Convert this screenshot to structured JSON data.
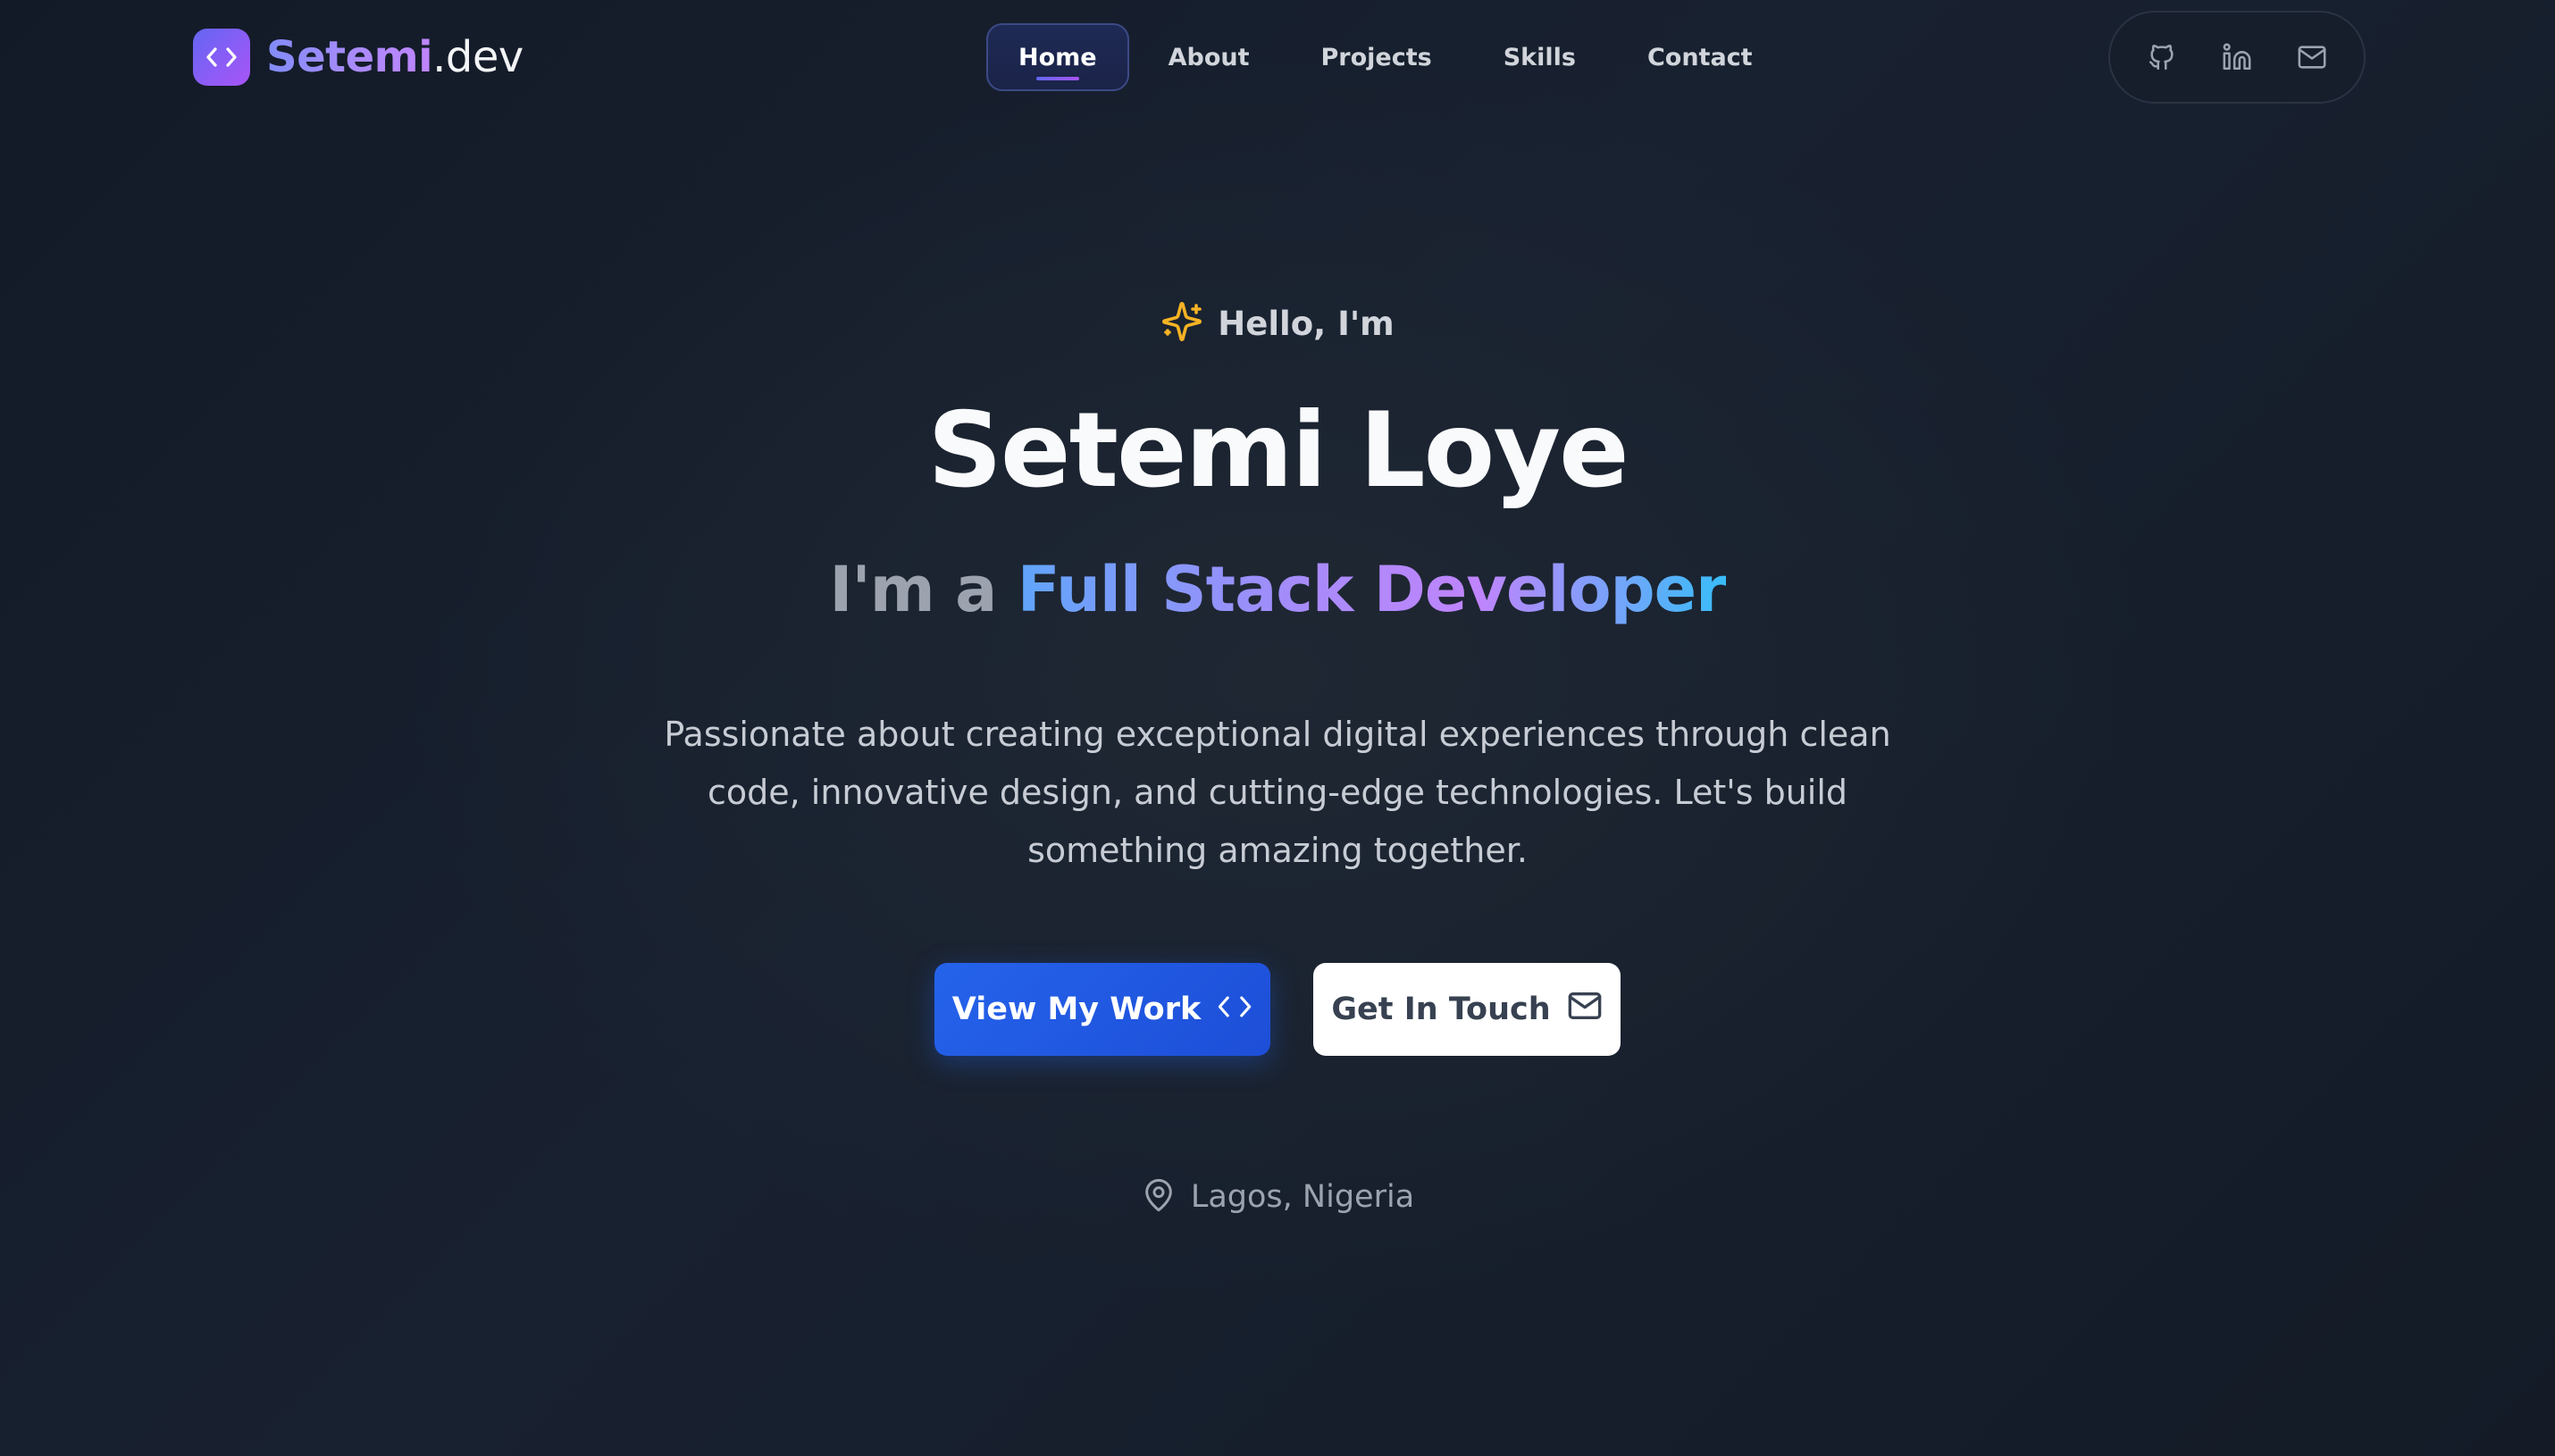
{
  "brand": {
    "name": "Setemi",
    "tld": ".dev",
    "icon": "code-brackets-icon",
    "gradient": [
      "#6366f1",
      "#a855f7"
    ]
  },
  "nav": {
    "items": [
      {
        "label": "Home",
        "active": true
      },
      {
        "label": "About",
        "active": false
      },
      {
        "label": "Projects",
        "active": false
      },
      {
        "label": "Skills",
        "active": false
      },
      {
        "label": "Contact",
        "active": false
      }
    ]
  },
  "social": {
    "icons": [
      "github-icon",
      "linkedin-icon",
      "mail-icon"
    ]
  },
  "hero": {
    "greeting": "Hello, I'm",
    "greeting_icon": "sparkles-icon",
    "name": "Setemi Loye",
    "role_prefix": "I'm a",
    "role": "Full Stack Developer",
    "bio": "Passionate about creating exceptional digital experiences through clean code, innovative design, and cutting-edge technologies. Let's build something amazing together.",
    "primary_button": "View My Work",
    "primary_icon": "code-brackets-icon",
    "secondary_button": "Get In Touch",
    "secondary_icon": "mail-icon",
    "location": "Lagos, Nigeria",
    "location_icon": "map-pin-icon"
  },
  "colors": {
    "background": "#161d2a",
    "accent_blue": "#2563eb",
    "accent_purple": "#a855f7",
    "sparkle": "#f5b324"
  }
}
